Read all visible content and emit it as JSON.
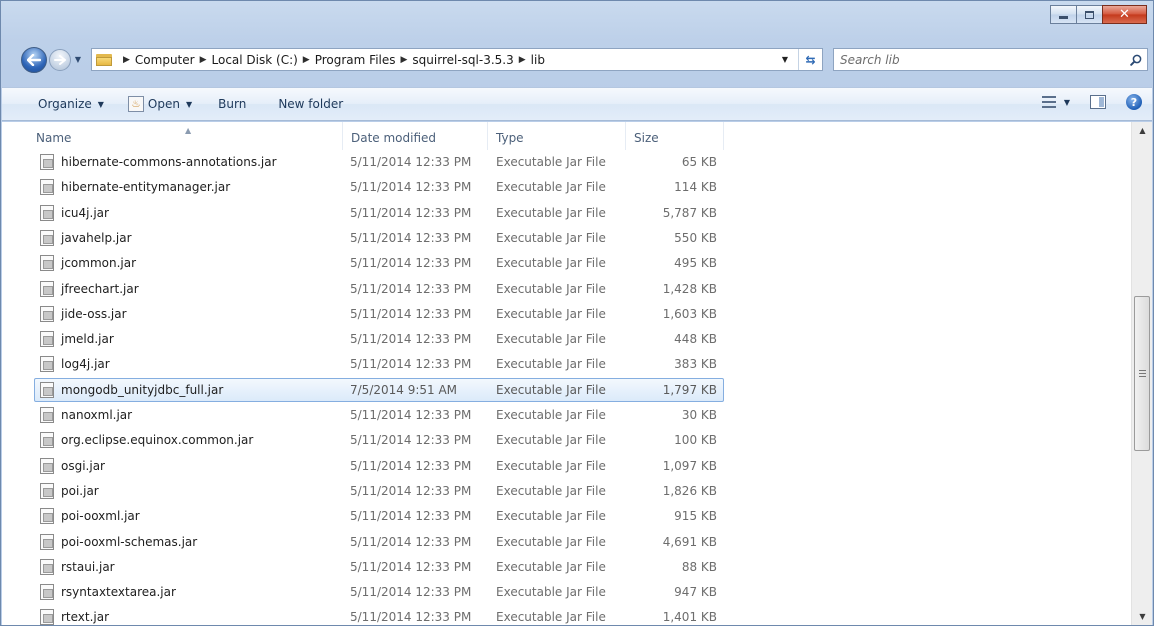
{
  "window": {
    "caption_buttons": [
      "minimize",
      "maximize",
      "close"
    ],
    "close_glyph": "✕"
  },
  "navigation": {
    "breadcrumbs": [
      "Computer",
      "Local Disk (C:)",
      "Program Files",
      "squirrel-sql-3.5.3",
      "lib"
    ],
    "search_placeholder": "Search lib"
  },
  "toolbar": {
    "organize_label": "Organize",
    "open_label": "Open",
    "burn_label": "Burn",
    "new_folder_label": "New folder"
  },
  "columns": {
    "name": "Name",
    "date": "Date modified",
    "type": "Type",
    "size": "Size"
  },
  "files": [
    {
      "name": "hibernate-commons-annotations.jar",
      "date": "5/11/2014 12:33 PM",
      "type": "Executable Jar File",
      "size": "65 KB"
    },
    {
      "name": "hibernate-entitymanager.jar",
      "date": "5/11/2014 12:33 PM",
      "type": "Executable Jar File",
      "size": "114 KB"
    },
    {
      "name": "icu4j.jar",
      "date": "5/11/2014 12:33 PM",
      "type": "Executable Jar File",
      "size": "5,787 KB"
    },
    {
      "name": "javahelp.jar",
      "date": "5/11/2014 12:33 PM",
      "type": "Executable Jar File",
      "size": "550 KB"
    },
    {
      "name": "jcommon.jar",
      "date": "5/11/2014 12:33 PM",
      "type": "Executable Jar File",
      "size": "495 KB"
    },
    {
      "name": "jfreechart.jar",
      "date": "5/11/2014 12:33 PM",
      "type": "Executable Jar File",
      "size": "1,428 KB"
    },
    {
      "name": "jide-oss.jar",
      "date": "5/11/2014 12:33 PM",
      "type": "Executable Jar File",
      "size": "1,603 KB"
    },
    {
      "name": "jmeld.jar",
      "date": "5/11/2014 12:33 PM",
      "type": "Executable Jar File",
      "size": "448 KB"
    },
    {
      "name": "log4j.jar",
      "date": "5/11/2014 12:33 PM",
      "type": "Executable Jar File",
      "size": "383 KB"
    },
    {
      "name": "mongodb_unityjdbc_full.jar",
      "date": "7/5/2014 9:51 AM",
      "type": "Executable Jar File",
      "size": "1,797 KB",
      "selected": true
    },
    {
      "name": "nanoxml.jar",
      "date": "5/11/2014 12:33 PM",
      "type": "Executable Jar File",
      "size": "30 KB"
    },
    {
      "name": "org.eclipse.equinox.common.jar",
      "date": "5/11/2014 12:33 PM",
      "type": "Executable Jar File",
      "size": "100 KB"
    },
    {
      "name": "osgi.jar",
      "date": "5/11/2014 12:33 PM",
      "type": "Executable Jar File",
      "size": "1,097 KB"
    },
    {
      "name": "poi.jar",
      "date": "5/11/2014 12:33 PM",
      "type": "Executable Jar File",
      "size": "1,826 KB"
    },
    {
      "name": "poi-ooxml.jar",
      "date": "5/11/2014 12:33 PM",
      "type": "Executable Jar File",
      "size": "915 KB"
    },
    {
      "name": "poi-ooxml-schemas.jar",
      "date": "5/11/2014 12:33 PM",
      "type": "Executable Jar File",
      "size": "4,691 KB"
    },
    {
      "name": "rstaui.jar",
      "date": "5/11/2014 12:33 PM",
      "type": "Executable Jar File",
      "size": "88 KB"
    },
    {
      "name": "rsyntaxtextarea.jar",
      "date": "5/11/2014 12:33 PM",
      "type": "Executable Jar File",
      "size": "947 KB"
    },
    {
      "name": "rtext.jar",
      "date": "5/11/2014 12:33 PM",
      "type": "Executable Jar File",
      "size": "1,401 KB"
    }
  ],
  "scroll": {
    "position_fraction": 0.5,
    "visible_fraction": 0.33
  },
  "colors": {
    "selection_border": "#85aee0",
    "window_frame": "#bdd0e9"
  }
}
